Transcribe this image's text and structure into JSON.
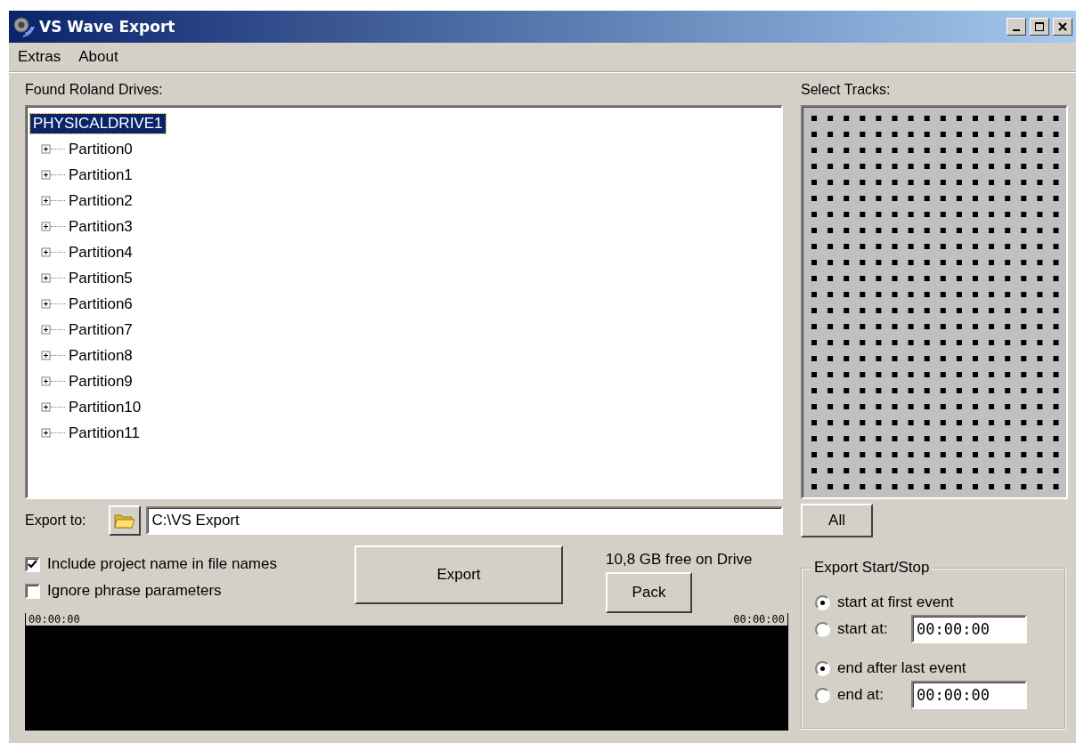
{
  "window": {
    "title": "VS Wave Export"
  },
  "menu": [
    {
      "label": "Extras"
    },
    {
      "label": "About"
    }
  ],
  "drives": {
    "label": "Found Roland Drives:",
    "tree": [
      {
        "label": "PHYSICALDRIVE1",
        "selected": true,
        "children": [
          {
            "label": "Partition0",
            "selected": false,
            "expanded": false
          },
          {
            "label": "Partition1",
            "selected": false,
            "expanded": false
          },
          {
            "label": "Partition2",
            "selected": false,
            "expanded": false
          },
          {
            "label": "Partition3",
            "selected": false,
            "expanded": false
          },
          {
            "label": "Partition4",
            "selected": false,
            "expanded": false
          },
          {
            "label": "Partition5",
            "selected": false,
            "expanded": false
          },
          {
            "label": "Partition6",
            "selected": false,
            "expanded": false
          },
          {
            "label": "Partition7",
            "selected": false,
            "expanded": false
          },
          {
            "label": "Partition8",
            "selected": false,
            "expanded": false
          },
          {
            "label": "Partition9",
            "selected": false,
            "expanded": false
          },
          {
            "label": "Partition10",
            "selected": false,
            "expanded": false
          },
          {
            "label": "Partition11",
            "selected": false,
            "expanded": false
          }
        ]
      }
    ]
  },
  "tracks": {
    "label": "Select Tracks:",
    "button": "All"
  },
  "export_to": {
    "label": "Export to:",
    "value": "C:\\VS Export"
  },
  "options": [
    {
      "label": "Include project name in file names",
      "checked": true
    },
    {
      "label": "Ignore phrase parameters",
      "checked": false
    }
  ],
  "export_button": "Export",
  "free_space": "10,8 GB free on Drive",
  "pack_button": "Pack",
  "timeline": {
    "start": "00:00:00",
    "end": "00:00:00"
  },
  "start_stop": {
    "title": "Export Start/Stop",
    "rows": [
      {
        "kind": "radio",
        "label": "start at first event",
        "selected": true
      },
      {
        "kind": "radio-time",
        "label": "start at:",
        "selected": false,
        "value": "00:00:00"
      },
      {
        "kind": "radio",
        "label": "end after last event",
        "selected": true
      },
      {
        "kind": "radio-time",
        "label": "end at:",
        "selected": false,
        "value": "00:00:00"
      }
    ]
  }
}
